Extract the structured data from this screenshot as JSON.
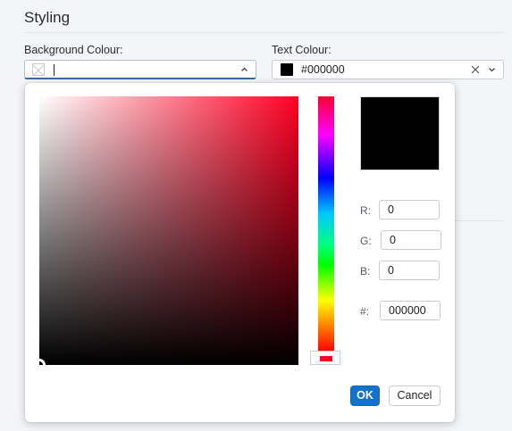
{
  "section": {
    "title": "Styling"
  },
  "background_colour": {
    "label": "Background Colour:",
    "value": "",
    "state": "no colour",
    "dropdown_open": true
  },
  "text_colour": {
    "label": "Text Colour:",
    "value": "#000000",
    "swatch_color": "#000000"
  },
  "color_picker": {
    "preview_color": "#000000",
    "hue_color": "#ff0022",
    "channels": {
      "r": {
        "label": "R:",
        "value": "0"
      },
      "g": {
        "label": "G:",
        "value": "0"
      },
      "b": {
        "label": "B:",
        "value": "0"
      },
      "hex": {
        "label": "#:",
        "value": "000000"
      }
    },
    "buttons": {
      "ok": "OK",
      "cancel": "Cancel"
    }
  },
  "colors": {
    "accent": "#1473c9",
    "page_background": "#f3f5f9"
  },
  "icons": {
    "no_colour": "no-colour-swatch-icon",
    "open_arrow": "chevron-up-icon",
    "dropdown_arrow": "chevron-down-icon",
    "clear": "close-icon"
  }
}
